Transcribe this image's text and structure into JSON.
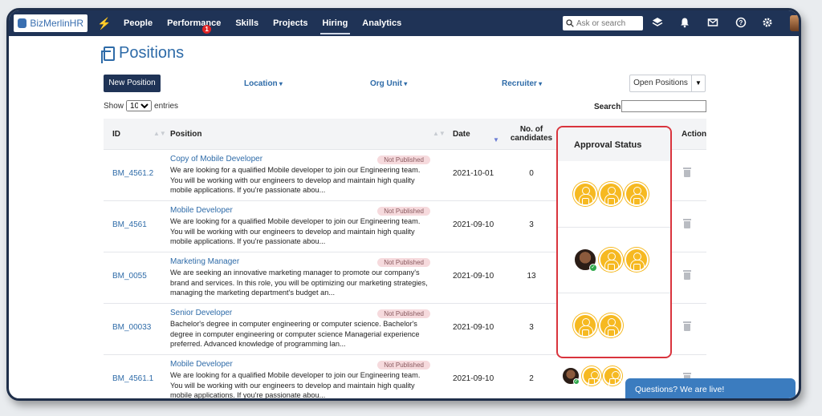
{
  "navbar": {
    "logo_text": "BizMerlinHR",
    "items": [
      {
        "label": "People"
      },
      {
        "label": "Performance",
        "badge": "1"
      },
      {
        "label": "Skills"
      },
      {
        "label": "Projects"
      },
      {
        "label": "Hiring",
        "active": true
      },
      {
        "label": "Analytics"
      }
    ],
    "search_placeholder": "Ask or search",
    "icons": [
      "layers-icon",
      "bell-icon",
      "mail-icon",
      "help-icon",
      "gear-icon"
    ]
  },
  "page": {
    "title": "Positions",
    "new_button": "New Position",
    "filters": [
      "Location",
      "Org Unit",
      "Recruiter"
    ],
    "status_select": "Open Positions",
    "show_label": "Show",
    "entries_value": "10",
    "entries_label": "entries",
    "search_label": "Search:"
  },
  "table": {
    "headers": {
      "id": "ID",
      "position": "Position",
      "date": "Date",
      "candidates": "No. of candidates",
      "approval": "Approval Status",
      "action": "Action"
    },
    "rows": [
      {
        "id": "BM_4561.2",
        "title": "Copy of Mobile Developer",
        "badge": "Not Published",
        "description": "We are looking for a qualified Mobile developer to join our Engineering team. You will be working with our engineers to develop and maintain high quality mobile applications. If you're passionate abou...",
        "date": "2021-10-01",
        "candidates": "0",
        "approvers": [
          "pending",
          "pending",
          "pending"
        ]
      },
      {
        "id": "BM_4561",
        "title": "Mobile Developer",
        "badge": "Not Published",
        "description": "We are looking for a qualified Mobile developer to join our Engineering team. You will be working with our engineers to develop and maintain high quality mobile applications. If you're passionate abou...",
        "date": "2021-09-10",
        "candidates": "3",
        "approvers": [
          "approved",
          "pending",
          "pending"
        ]
      },
      {
        "id": "BM_0055",
        "title": "Marketing Manager",
        "badge": "Not Published",
        "description": "We are seeking an innovative marketing manager to promote our company's brand and services. In this role, you will be optimizing our marketing strategies, managing the marketing department's budget an...",
        "date": "2021-09-10",
        "candidates": "13",
        "approvers": [
          "pending",
          "pending"
        ]
      },
      {
        "id": "BM_00033",
        "title": "Senior Developer",
        "badge": "Not Published",
        "description": "Bachelor's degree in computer engineering or computer science. Bachelor's degree in computer engineering or computer science Managerial experience preferred. Advanced knowledge of programming lan...",
        "date": "2021-09-10",
        "candidates": "3",
        "approvers": []
      },
      {
        "id": "BM_4561.1",
        "title": "Mobile Developer",
        "badge": "Not Published",
        "description": "We are looking for a qualified Mobile developer to join our Engineering team. You will be working with our engineers to develop and maintain high quality mobile applications. If you're passionate abou...",
        "date": "2021-09-10",
        "candidates": "2",
        "approvers": [
          "approved",
          "pending",
          "pending"
        ]
      }
    ]
  },
  "chat": {
    "label": "Questions? We are live!"
  }
}
